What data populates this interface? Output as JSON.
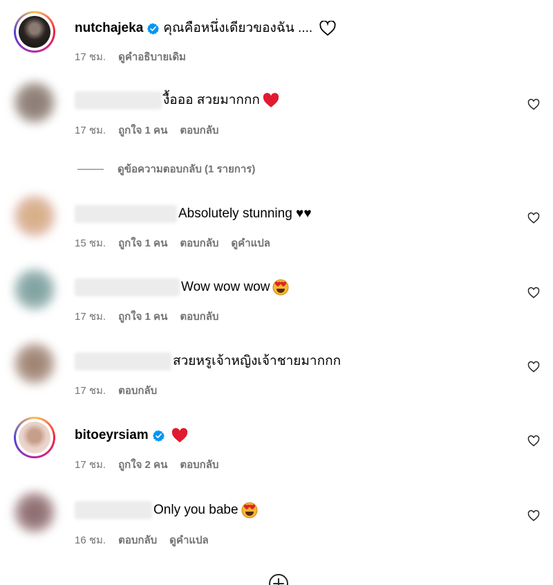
{
  "caption": {
    "username": "nutchajeka",
    "text": "คุณคือหนึ่งเดียวของฉัน ....",
    "time": "17 ชม.",
    "see_original": "ดูคำอธิบายเดิม"
  },
  "comments": [
    {
      "text": "งื้อออ สวยมากกก",
      "time": "17 ชม.",
      "likes": "ถูกใจ 1 คน",
      "reply": "ตอบกลับ",
      "emoji": "red-heart"
    },
    {
      "text": "Absolutely stunning ♥♥",
      "time": "15 ชม.",
      "likes": "ถูกใจ 1 คน",
      "reply": "ตอบกลับ",
      "translate": "ดูคำแปล"
    },
    {
      "text": "Wow wow wow",
      "time": "17 ชม.",
      "likes": "ถูกใจ 1 คน",
      "reply": "ตอบกลับ",
      "emoji": "heart-eyes"
    },
    {
      "text": "สวยหรูเจ้าหญิงเจ้าชายมากกก",
      "time": "17 ชม.",
      "reply": "ตอบกลับ"
    },
    {
      "username": "bitoeyrsiam",
      "time": "17 ชม.",
      "likes": "ถูกใจ 2 คน",
      "reply": "ตอบกลับ",
      "emoji": "red-heart"
    },
    {
      "text": "Only you babe",
      "time": "16 ชม.",
      "reply": "ตอบกลับ",
      "translate": "ดูคำแปล",
      "emoji": "heart-eyes"
    }
  ],
  "view_replies": "ดูข้อความตอบกลับ (1 รายการ)",
  "colors": {
    "meta": "#737373",
    "verified": "#0095f6",
    "heart": "#ff3040"
  }
}
